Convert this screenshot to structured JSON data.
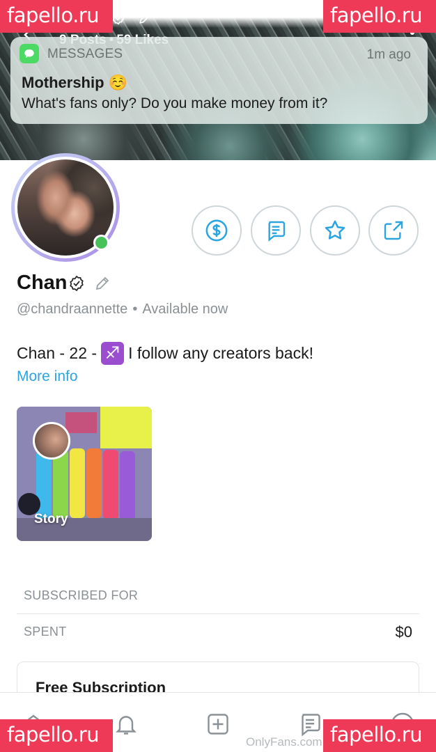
{
  "cover": {
    "posts_count": "9 Posts",
    "likes_count": "59 Likes"
  },
  "notification": {
    "app_name": "MESSAGES",
    "time": "1m ago",
    "sender": "Mothership ☺️",
    "body": "What's fans only? Do you make money from it?"
  },
  "watermark": {
    "text": "fapello.ru"
  },
  "profile": {
    "name": "Chan",
    "handle": "@chandraannette",
    "status": "Available now",
    "bio_prefix": "Chan - 22 -",
    "bio_emoji": "♐",
    "bio_suffix": "I follow any creators back!",
    "more_info": "More info"
  },
  "story": {
    "label": "Story"
  },
  "subscription": {
    "subscribed_for_label": "SUBSCRIBED FOR",
    "spent_label": "SPENT",
    "spent_value": "$0",
    "card_title": "Free Subscription"
  },
  "footer": {
    "brand": "OnlyFans.com"
  },
  "colors": {
    "accent": "#2ba5e0",
    "online": "#47c15a",
    "watermark": "#ee3a57",
    "zodiac": "#9b4dcf"
  },
  "icons": {
    "tip": "dollar-circle-icon",
    "message": "message-icon",
    "favorite": "star-icon",
    "share": "share-icon",
    "home": "home-icon",
    "notifications": "bell-icon",
    "add": "plus-square-icon",
    "messages": "message-icon",
    "profile": "user-circle-icon"
  }
}
